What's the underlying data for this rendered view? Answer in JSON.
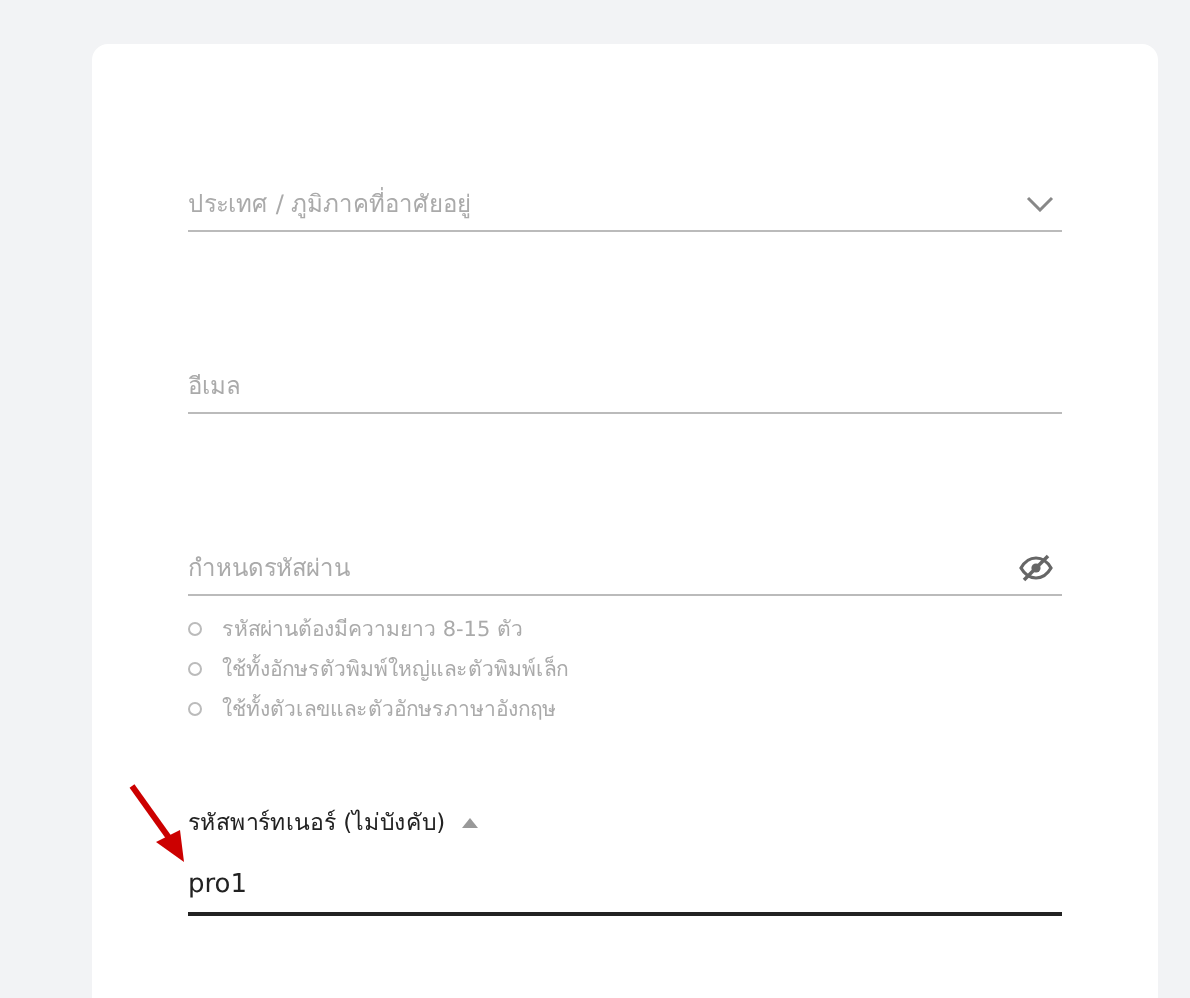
{
  "fields": [
    {
      "kind": "select",
      "placeholder": "ประเทศ / ภูมิภาคที่อาศัยอยู่"
    },
    {
      "kind": "text",
      "placeholder": "อีเมล"
    },
    {
      "kind": "password",
      "placeholder": "กำหนดรหัสผ่าน",
      "hints": [
        "รหัสผ่านต้องมีความยาว 8-15 ตัว",
        "ใช้ทั้งอักษรตัวพิมพ์ใหญ่และตัวพิมพ์เล็ก",
        "ใช้ทั้งตัวเลขและตัวอักษรภาษาอังกฤษ"
      ]
    },
    {
      "kind": "labeled",
      "label": "รหัสพาร์ทเนอร์ (ไม่บังคับ)",
      "expanded": true,
      "value": "pro1"
    }
  ]
}
